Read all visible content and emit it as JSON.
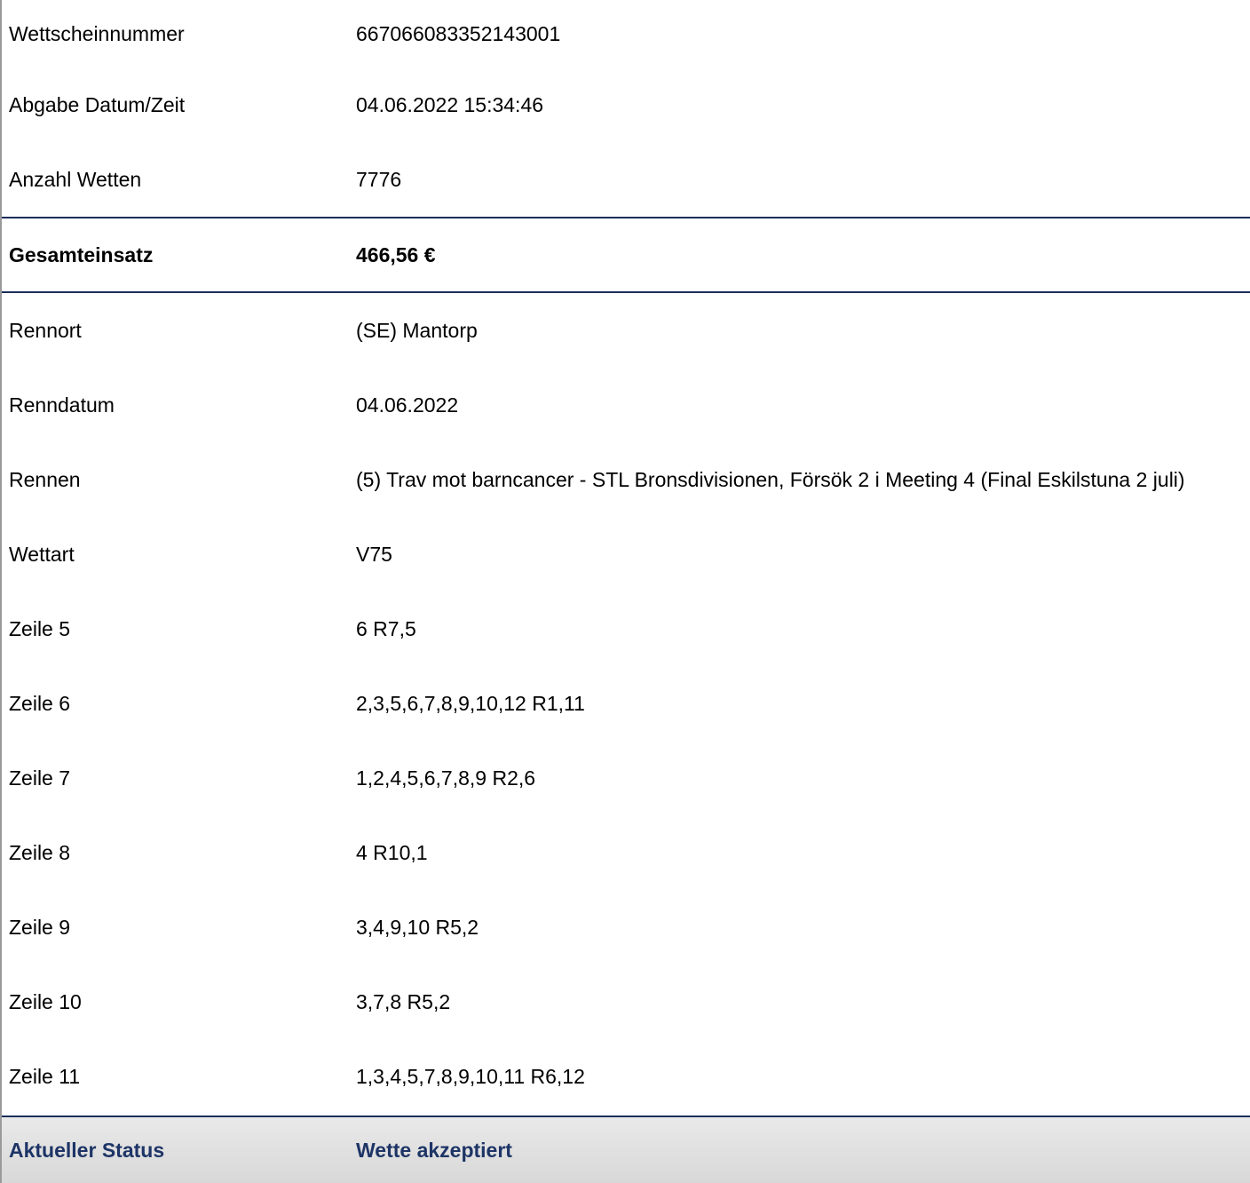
{
  "ticket": {
    "number_label": "Wettscheinnummer",
    "number_value": "667066083352143001",
    "submitted_label": "Abgabe Datum/Zeit",
    "submitted_value": "04.06.2022 15:34:46",
    "bets_count_label": "Anzahl Wetten",
    "bets_count_value": "7776"
  },
  "total": {
    "label": "Gesamteinsatz",
    "value": "466,56 €"
  },
  "race": {
    "venue_label": "Rennort",
    "venue_value": "(SE) Mantorp",
    "date_label": "Renndatum",
    "date_value": "04.06.2022",
    "race_label": "Rennen",
    "race_value": "(5) Trav mot barncancer - STL Bronsdivisionen, Försök 2 i Meeting 4 (Final Eskilstuna 2 juli)",
    "bet_type_label": "Wettart",
    "bet_type_value": "V75"
  },
  "lines": [
    {
      "label": "Zeile 5",
      "value": "6 R7,5"
    },
    {
      "label": "Zeile 6",
      "value": "2,3,5,6,7,8,9,10,12 R1,11"
    },
    {
      "label": "Zeile 7",
      "value": "1,2,4,5,6,7,8,9 R2,6"
    },
    {
      "label": "Zeile 8",
      "value": "4 R10,1"
    },
    {
      "label": "Zeile 9",
      "value": "3,4,9,10 R5,2"
    },
    {
      "label": "Zeile 10",
      "value": "3,7,8 R5,2"
    },
    {
      "label": "Zeile 11",
      "value": "1,3,4,5,7,8,9,10,11 R6,12"
    }
  ],
  "status": {
    "label": "Aktueller Status",
    "value": "Wette akzeptiert"
  },
  "colors": {
    "divider": "#1a2e5a",
    "status_text": "#1d3466",
    "status_background": "#e0e0e0"
  }
}
